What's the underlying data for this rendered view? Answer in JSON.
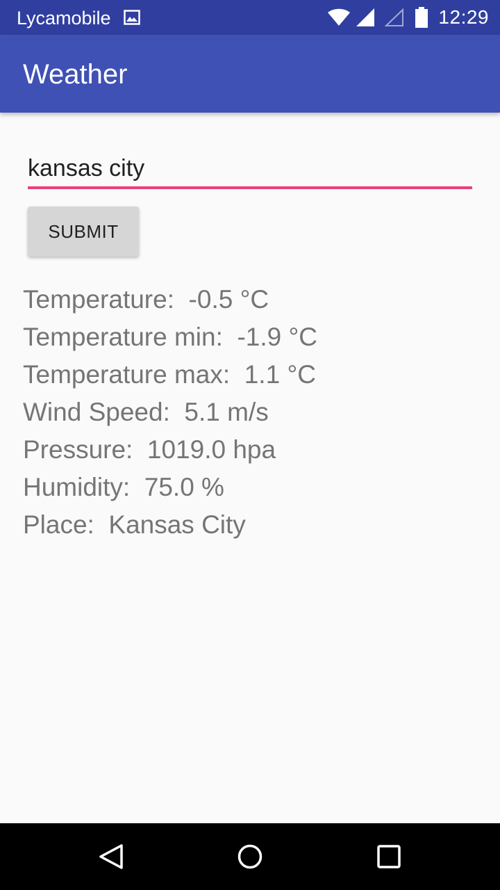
{
  "status_bar": {
    "carrier": "Lycamobile",
    "time": "12:29",
    "icons": [
      "image-icon",
      "wifi-icon",
      "cell-signal-icon",
      "cell-signal-empty-icon",
      "battery-icon"
    ]
  },
  "app_bar": {
    "title": "Weather"
  },
  "search": {
    "value": "kansas city"
  },
  "submit_button": {
    "label": "SUBMIT"
  },
  "results": {
    "temperature": "Temperature:  -0.5 °C",
    "temperature_min": "Temperature min:  -1.9 °C",
    "temperature_max": "Temperature max:  1.1 °C",
    "wind_speed": "Wind Speed:  5.1 m/s",
    "pressure": "Pressure:  1019.0 hpa",
    "humidity": "Humidity:  75.0 %",
    "place": "Place:  Kansas City"
  },
  "nav_bar": {
    "icons": [
      "back-icon",
      "home-icon",
      "recents-icon"
    ]
  },
  "colors": {
    "status_bar": "#303f9f",
    "app_bar": "#3f51b5",
    "accent": "#ec407a",
    "result_text": "#757575"
  }
}
